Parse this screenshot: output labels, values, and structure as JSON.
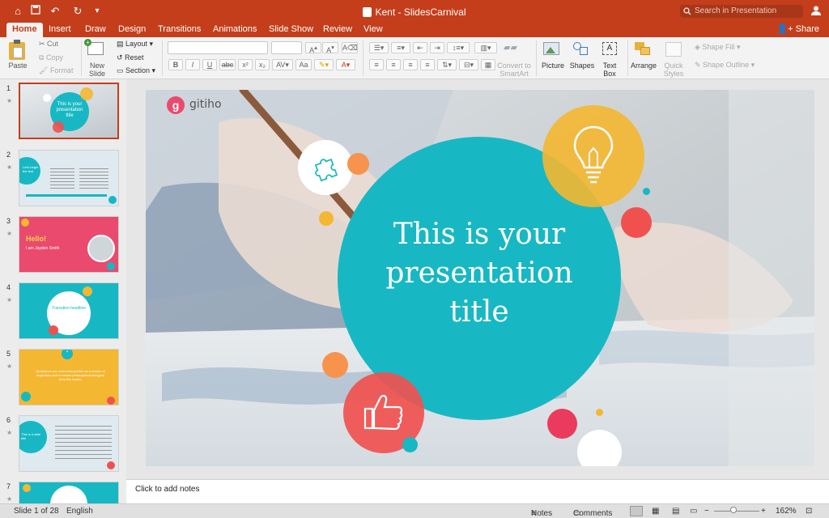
{
  "window": {
    "title": "Kent - SlidesCarnival",
    "search_placeholder": "Search in Presentation"
  },
  "tabs": [
    "Home",
    "Insert",
    "Draw",
    "Design",
    "Transitions",
    "Animations",
    "Slide Show",
    "Review",
    "View"
  ],
  "share_label": "Share",
  "ribbon": {
    "paste": "Paste",
    "cut": "Cut",
    "copy": "Copy",
    "format": "Format",
    "new_slide": [
      "New",
      "Slide"
    ],
    "layout": "Layout",
    "reset": "Reset",
    "section": "Section",
    "convert": [
      "Convert to",
      "SmartArt"
    ],
    "picture": "Picture",
    "shapes": "Shapes",
    "textbox": [
      "Text",
      "Box"
    ],
    "arrange": "Arrange",
    "quick_styles": [
      "Quick",
      "Styles"
    ],
    "shape_fill": "Shape Fill",
    "shape_outline": "Shape Outline"
  },
  "thumbnails": [
    {
      "num": "1",
      "title": "This is your presentation title"
    },
    {
      "num": "2",
      "title": "Let's begin the test"
    },
    {
      "num": "3",
      "title": "Hello!",
      "subtitle": "I am Jayden Smith"
    },
    {
      "num": "4",
      "title": "Transition headline"
    },
    {
      "num": "5",
      "title": "Quotations are commonly printed as a means of inspiration and to invoke philosophical thoughts from the reader."
    },
    {
      "num": "6",
      "title": "This is a slide title"
    },
    {
      "num": "7",
      "title": ""
    }
  ],
  "slide": {
    "logo_text": "gitiho",
    "title_lines": [
      "This is your",
      "presentation",
      "title"
    ]
  },
  "notes_placeholder": "Click to add notes",
  "status": {
    "slide_count": "Slide 1 of 28",
    "language": "English",
    "notes": "Notes",
    "comments": "Comments",
    "zoom": "162%"
  },
  "colors": {
    "accent": "#c43e1c",
    "teal": "#17b8c3",
    "yellow": "#f4b731",
    "red": "#f0514f",
    "orange": "#f7934c",
    "pink": "#ea4a6e"
  }
}
